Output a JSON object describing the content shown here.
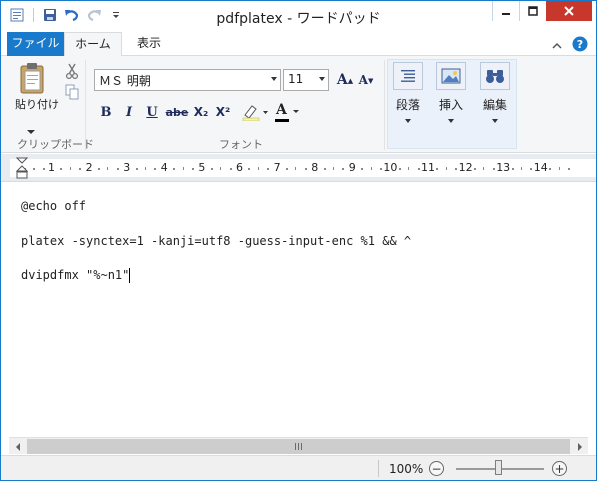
{
  "window": {
    "title": "pdfplatex - ワードパッド"
  },
  "quick_access": {
    "icons": [
      "save-icon",
      "undo-icon",
      "redo-icon",
      "customize-qat-icon"
    ]
  },
  "tabs": [
    {
      "label": "ファイル",
      "active": false
    },
    {
      "label": "ホーム",
      "active": true
    },
    {
      "label": "表示",
      "active": false
    }
  ],
  "ribbon": {
    "clipboard": {
      "paste_label": "貼り付け",
      "group_label": "クリップボード"
    },
    "font": {
      "font_name": "ＭＳ 明朝",
      "font_size": "11",
      "grow_label": "A",
      "shrink_label": "A",
      "bold": "B",
      "italic": "I",
      "underline": "U",
      "strike": "abe",
      "subscript": "X₂",
      "superscript": "X²",
      "color": "A",
      "group_label": "フォント"
    },
    "paragraph_label": "段落",
    "insert_label": "挿入",
    "edit_label": "編集"
  },
  "ruler": {
    "numbers": [
      "1",
      "2",
      "3",
      "4",
      "5",
      "6",
      "7",
      "8",
      "9",
      "10",
      "11",
      "12",
      "13",
      "14"
    ]
  },
  "document": {
    "lines": [
      "@echo off",
      "platex -synctex=1 -kanji=utf8 -guess-input-enc %1 && ^",
      "dvipdfmx \"%~n1\""
    ]
  },
  "status": {
    "zoom": "100%",
    "zoom_out": "−",
    "zoom_in": "+"
  },
  "colors": {
    "accent": "#1979ca",
    "close": "#c7372c"
  }
}
